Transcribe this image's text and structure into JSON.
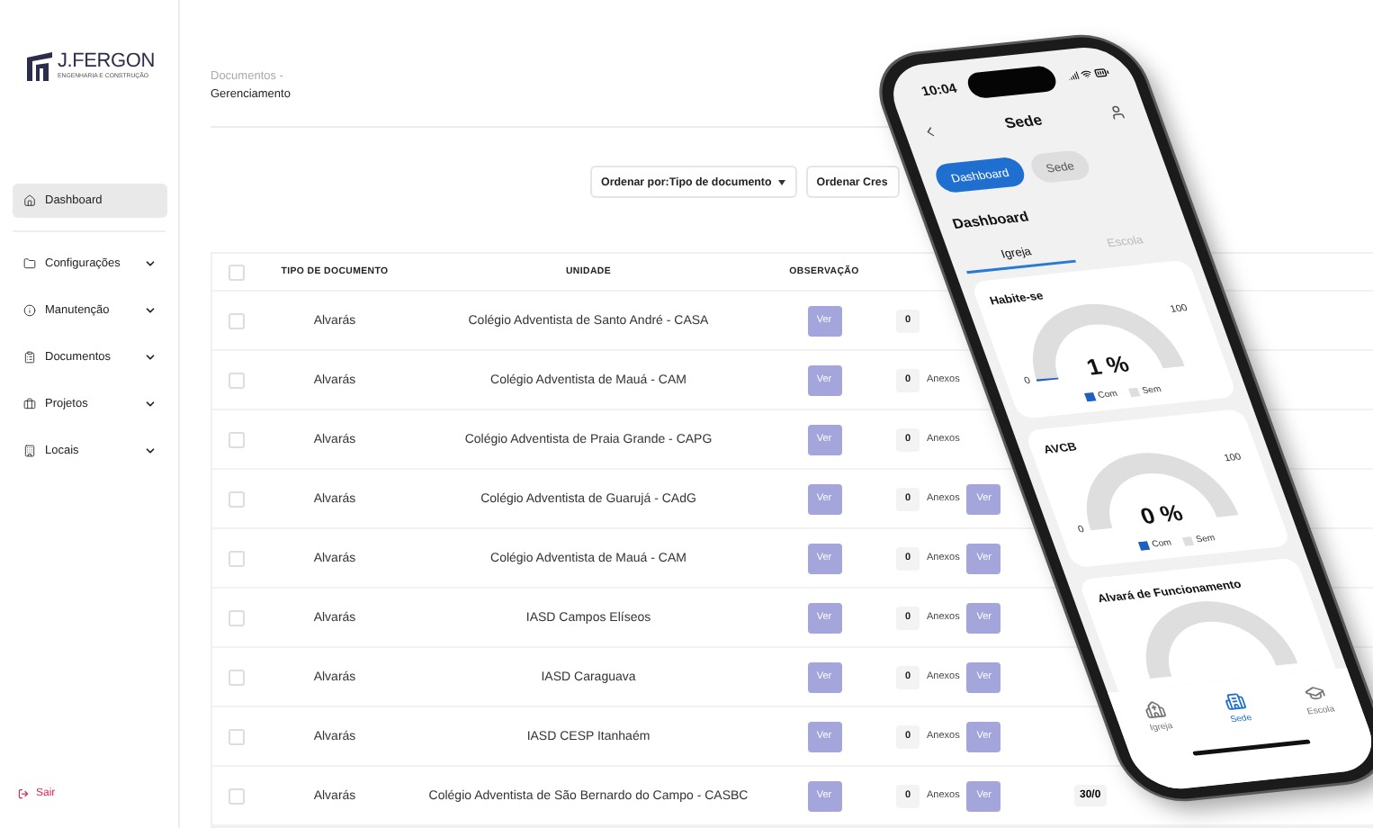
{
  "sidebar": {
    "logo": {
      "name": "J.FERGON",
      "tagline": "ENGENHARIA E CONSTRUÇÃO"
    },
    "items": [
      {
        "kind": "home",
        "label": "Dashboard",
        "selected": true
      },
      {
        "kind": "folder",
        "label": "Configurações",
        "selected": false
      },
      {
        "kind": "info",
        "label": "Manutenção",
        "selected": false
      },
      {
        "kind": "clipboard",
        "label": "Documentos",
        "selected": false
      },
      {
        "kind": "briefcase",
        "label": "Projetos",
        "selected": false
      },
      {
        "kind": "building",
        "label": "Locais",
        "selected": false
      }
    ],
    "logout": "Sair"
  },
  "breadcrumb": {
    "parent": "Documentos -",
    "current": "Gerenciamento"
  },
  "sort_buttons": [
    {
      "label": "Ordenar por:Tipo de documento",
      "caret": true
    },
    {
      "label": "Ordenar Cres",
      "caret": false
    }
  ],
  "table": {
    "header_checked": false,
    "columns": [
      "TIPO DE DOCUMENTO",
      "UNIDADE",
      "OBSERVAÇÃO"
    ],
    "rows": [
      {
        "checked": false,
        "type": "Alvarás",
        "unit": "Colégio Adventista de Santo André - CASA",
        "observation": "Ver",
        "attachments_count": "0"
      },
      {
        "checked": false,
        "type": "Alvarás",
        "unit": "Colégio Adventista de Mauá - CAM",
        "observation": "Ver",
        "attachments_count": "0",
        "attachments_label": "Anexos"
      },
      {
        "checked": false,
        "type": "Alvarás",
        "unit": "Colégio Adventista de Praia Grande - CAPG",
        "observation": "Ver",
        "attachments_count": "0",
        "attachments_label": "Anexos"
      },
      {
        "checked": false,
        "type": "Alvarás",
        "unit": "Colégio Adventista de Guarujá - CAdG",
        "observation": "Ver",
        "attachments_count": "0",
        "attachments_label": "Anexos",
        "attachments_button": "Ver"
      },
      {
        "checked": false,
        "type": "Alvarás",
        "unit": "Colégio Adventista de Mauá - CAM",
        "observation": "Ver",
        "attachments_count": "0",
        "attachments_label": "Anexos",
        "attachments_button": "Ver"
      },
      {
        "checked": false,
        "type": "Alvarás",
        "unit": "IASD Campos Elíseos",
        "observation": "Ver",
        "attachments_count": "0",
        "attachments_label": "Anexos",
        "attachments_button": "Ver"
      },
      {
        "checked": false,
        "type": "Alvarás",
        "unit": "IASD Caraguava",
        "observation": "Ver",
        "attachments_count": "0",
        "attachments_label": "Anexos",
        "attachments_button": "Ver"
      },
      {
        "checked": false,
        "type": "Alvarás",
        "unit": "IASD CESP Itanhaém",
        "observation": "Ver",
        "attachments_count": "0",
        "attachments_label": "Anexos",
        "attachments_button": "Ver"
      },
      {
        "checked": false,
        "type": "Alvarás",
        "unit": "Colégio Adventista de São Bernardo do Campo - CASBC",
        "observation": "Ver",
        "attachments_count": "0",
        "attachments_label": "Anexos",
        "attachments_button": "Ver",
        "column_5": "30/0"
      }
    ]
  },
  "phone": {
    "time": "10:04",
    "title": "Sede",
    "pills": [
      {
        "label": "Dashboard",
        "selected": true
      },
      {
        "label": "Sede",
        "selected": false
      }
    ],
    "heading": "Dashboard",
    "tabs": [
      {
        "label": "Igreja",
        "selected": true
      },
      {
        "label": "Escola",
        "selected": false
      }
    ],
    "cards": [
      {
        "title": "Habite-se",
        "reading": "1 %",
        "min": "0",
        "max": "100",
        "legend": [
          "Com",
          "Sem"
        ]
      },
      {
        "title": "AVCB",
        "reading": "0 %",
        "min": "0",
        "max": "100",
        "legend": [
          "Com",
          "Sem"
        ]
      },
      {
        "title": "Alvará de Funcionamento"
      }
    ],
    "nav": [
      {
        "kind": "church",
        "label": "Igreja",
        "selected": false
      },
      {
        "kind": "building",
        "label": "Sede",
        "selected": true
      },
      {
        "kind": "school",
        "label": "Escola",
        "selected": false
      }
    ]
  }
}
